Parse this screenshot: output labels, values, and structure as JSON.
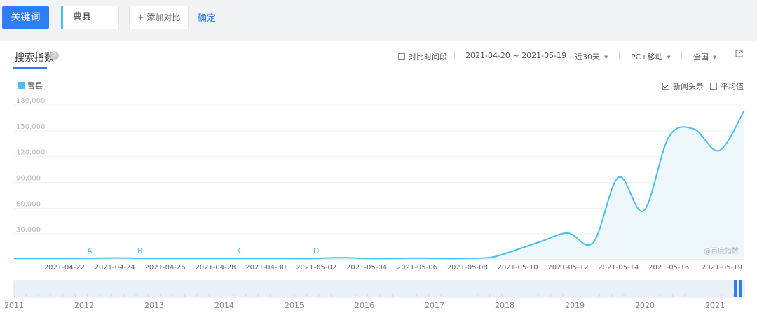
{
  "toolbar": {
    "keyword_button": "关键词",
    "keyword_value": "曹县",
    "add_compare": "+ 添加对比",
    "confirm": "确定"
  },
  "panel": {
    "tab_title": "搜索指数",
    "compare_period": "对比时间段",
    "date_range": "2021-04-20 ~ 2021-05-19",
    "period_select": "近30天",
    "device_select": "PC+移动",
    "region_select": "全国",
    "news_label": "新闻头条",
    "average_label": "平均值",
    "watermark": "@百度指数"
  },
  "colors": {
    "accent": "#2f7df6",
    "series": "#45c0ef",
    "fill": "#eef8fc"
  },
  "chart_data": {
    "type": "area",
    "title": "",
    "xlabel": "",
    "ylabel": "",
    "ylim": [
      0,
      180000
    ],
    "yticks": [
      30000,
      60000,
      90000,
      120000,
      150000,
      180000
    ],
    "ytick_labels": [
      "30,000",
      "60,000",
      "90,000",
      "120,000",
      "150,000",
      "180,000"
    ],
    "x": [
      "2021-04-20",
      "2021-04-21",
      "2021-04-22",
      "2021-04-23",
      "2021-04-24",
      "2021-04-25",
      "2021-04-26",
      "2021-04-27",
      "2021-04-28",
      "2021-04-29",
      "2021-04-30",
      "2021-05-01",
      "2021-05-02",
      "2021-05-03",
      "2021-05-04",
      "2021-05-05",
      "2021-05-06",
      "2021-05-07",
      "2021-05-08",
      "2021-05-09",
      "2021-05-10",
      "2021-05-11",
      "2021-05-12",
      "2021-05-13",
      "2021-05-14",
      "2021-05-15",
      "2021-05-16",
      "2021-05-17",
      "2021-05-18",
      "2021-05-19"
    ],
    "xtick_labels": [
      "2021-04-22",
      "2021-04-24",
      "2021-04-26",
      "2021-04-28",
      "2021-04-30",
      "2021-05-02",
      "2021-05-04",
      "2021-05-06",
      "2021-05-08",
      "2021-05-10",
      "2021-05-12",
      "2021-05-14",
      "2021-05-16",
      "2021-05-19"
    ],
    "series": [
      {
        "name": "曹县",
        "values": [
          1500,
          1500,
          1500,
          1600,
          2000,
          1600,
          1500,
          1500,
          1500,
          1500,
          1500,
          1500,
          1500,
          2300,
          1500,
          1500,
          1800,
          1500,
          1600,
          3000,
          12000,
          22000,
          31000,
          20000,
          96000,
          57000,
          143000,
          152000,
          127000,
          174000
        ]
      }
    ],
    "annotations": [
      {
        "label": "A",
        "x": "2021-04-23"
      },
      {
        "label": "B",
        "x": "2021-04-25"
      },
      {
        "label": "C",
        "x": "2021-04-29"
      },
      {
        "label": "D",
        "x": "2021-05-02"
      }
    ],
    "grid": true,
    "legend": "top-left",
    "timeline_years": [
      "2011",
      "2012",
      "2013",
      "2014",
      "2015",
      "2016",
      "2017",
      "2018",
      "2019",
      "2020",
      "2021"
    ]
  }
}
